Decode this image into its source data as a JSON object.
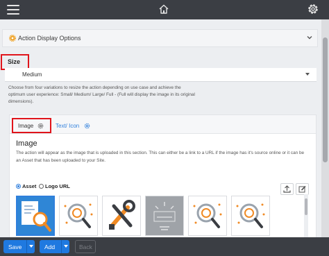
{
  "topbar": {
    "menu_icon": "hamburger-icon",
    "home_icon": "home-icon",
    "settings_icon": "gear-icon"
  },
  "section": {
    "title": "Action Display Options",
    "icon": "gear-icon",
    "toggle_icon": "chevron-down-icon"
  },
  "size": {
    "label": "Size",
    "selected": "Medium",
    "description": "Choose from four variations to resize the action depending on use case and achieve the optimum user experience: Small/ Medium/ Large/ Full - (Full will display the image in its original dimensions)."
  },
  "tabs": [
    {
      "label": "Image",
      "active": true
    },
    {
      "label": "Text/ Icon",
      "active": false
    }
  ],
  "image_section": {
    "title": "Image",
    "description": "The action will appear as the image that is uploaded in this section. This can either be a link to a URL if the image has it's source online or it can be an Asset that has been uploaded to your Site.",
    "source_options": [
      {
        "label": "Asset",
        "selected": true
      },
      {
        "label": "Logo URL",
        "selected": false
      }
    ],
    "upload_icon": "upload-icon",
    "edit_icon": "edit-icon",
    "thumbnails": [
      {
        "name": "document-magnifier",
        "selected": true
      },
      {
        "name": "magnifier-chart",
        "selected": false
      },
      {
        "name": "tools-wrench",
        "selected": false
      },
      {
        "name": "add-idea-sketch",
        "selected": false
      },
      {
        "name": "magnifier-chart",
        "selected": false
      },
      {
        "name": "magnifier-chart",
        "selected": false
      }
    ]
  },
  "footer": {
    "save_label": "Save",
    "add_label": "Add",
    "back_label": "Back"
  },
  "colors": {
    "accent": "#1f79e0",
    "topbar": "#3b3e44",
    "highlight": "#e0141b",
    "orange": "#f08a24"
  }
}
